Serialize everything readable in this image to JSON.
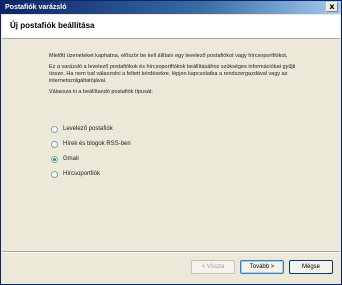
{
  "window": {
    "title": "Postafiók varázsló",
    "close_glyph": "x"
  },
  "header": {
    "heading": "Új postafiók beállítása"
  },
  "content": {
    "paragraph_1": "Mielőtt üzeneteket kaphatna, először be kell állítani egy levelező postafiókot vagy hírcsoportfiókot.",
    "paragraph_2": "Ez a varázsló a levelező postafiókok és hírcsoportfiókok beállításához szükséges információkat gyűjti össze. Ha nem tud válaszolni a feltett kérdésekre, lépjen kapcsolatba a rendszergazdával vagy az internetszolgáltatójával.",
    "paragraph_3": "Válassza ki a beállítandó postafiók típusát:"
  },
  "options": [
    {
      "label": "Levelező postafiók",
      "checked": false
    },
    {
      "label": "Hírek és blogok RSS-ben",
      "checked": false
    },
    {
      "label": "Gmail",
      "checked": true
    },
    {
      "label": "Hírcsoportfiók",
      "checked": false
    }
  ],
  "buttons": {
    "back": "< Vissza",
    "next": "Tovább >",
    "cancel": "Mégse"
  }
}
